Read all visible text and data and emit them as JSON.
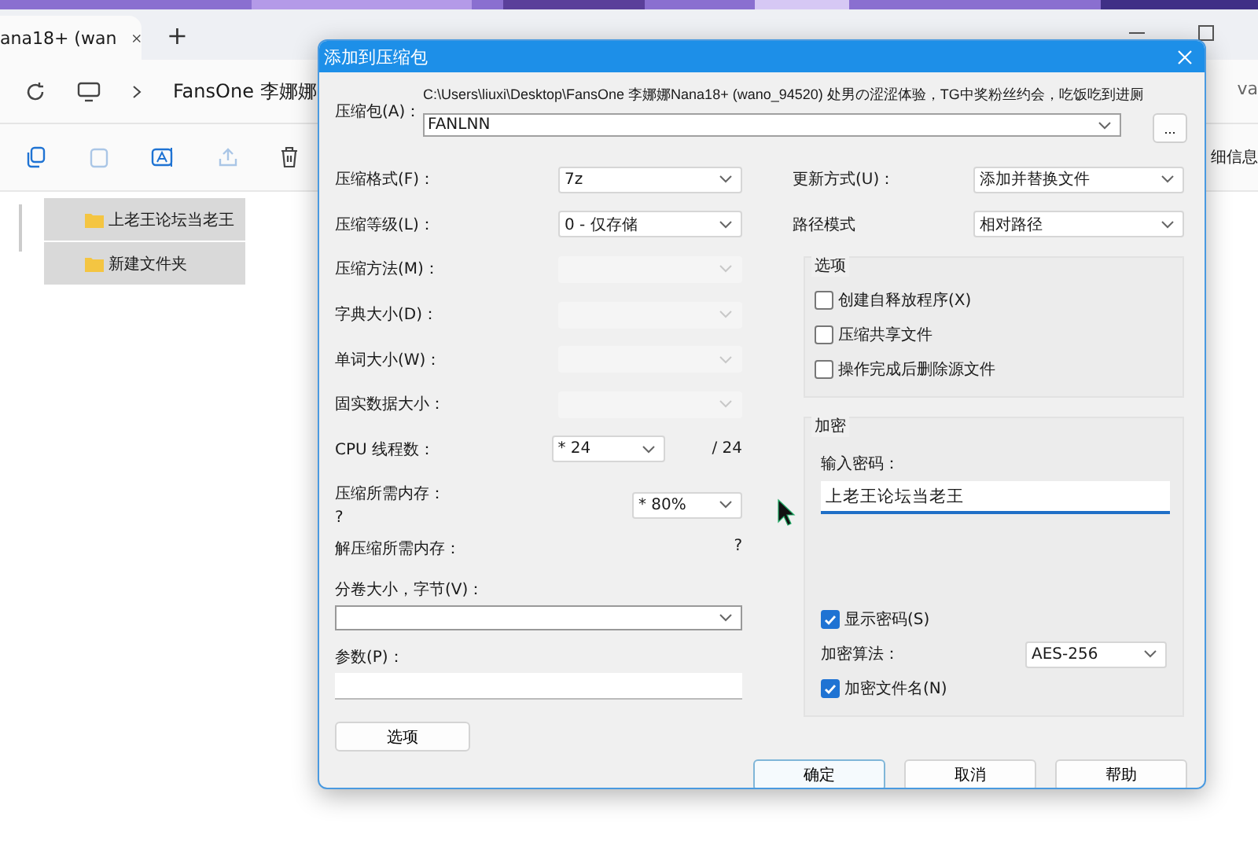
{
  "explorer": {
    "tab_title": "ana18+ (wan",
    "new_tab": "+",
    "breadcrumb": "FansOne 李娜娜",
    "search_partial": "va",
    "details": "细信息",
    "folders": [
      {
        "name": "上老王论坛当老王"
      },
      {
        "name": "新建文件夹"
      }
    ]
  },
  "dialog": {
    "title": "添加到压缩包",
    "archive_label": "压缩包(A)：",
    "archive_path": "C:\\Users\\liuxi\\Desktop\\FansOne 李娜娜Nana18+ (wano_94520) 处男の涩涩体验，TG中奖粉丝约会，吃饭吃到进厕",
    "archive_name": "FANLNN",
    "browse": "...",
    "left_fields": [
      {
        "kind": "select",
        "label": "压缩格式(F)：",
        "value": "7z",
        "disabled": false
      },
      {
        "kind": "select",
        "label": "压缩等级(L)：",
        "value": "0 - 仅存储",
        "disabled": false
      },
      {
        "kind": "select",
        "label": "压缩方法(M)：",
        "disabled": true
      },
      {
        "kind": "select",
        "label": "字典大小(D)：",
        "disabled": true
      },
      {
        "kind": "select",
        "label": "单词大小(W)：",
        "disabled": true
      },
      {
        "kind": "select",
        "label": "固实数据大小：",
        "disabled": true
      },
      {
        "kind": "threads",
        "label": "CPU 线程数：",
        "value": "* 24",
        "max": "/ 24"
      },
      {
        "kind": "memory",
        "label": "压缩所需内存：",
        "note": "?",
        "value": "* 80%"
      },
      {
        "kind": "info",
        "label": "解压缩所需内存：",
        "note": "?"
      },
      {
        "kind": "wide_select",
        "label": "分卷大小，字节(V)："
      },
      {
        "kind": "wide_input",
        "label": "参数(P)："
      }
    ],
    "update_label": "更新方式(U)：",
    "update_value": "添加并替换文件",
    "path_label": "路径模式",
    "path_value": "相对路径",
    "options_title": "选项",
    "options": [
      {
        "label": "创建自释放程序(X)",
        "checked": false
      },
      {
        "label": "压缩共享文件",
        "checked": false
      },
      {
        "label": "操作完成后删除源文件",
        "checked": false
      }
    ],
    "encryption_title": "加密",
    "password_label": "输入密码：",
    "password_value": "上老王论坛当老王",
    "show_password": {
      "label": "显示密码(S)",
      "checked": true
    },
    "algorithm_label": "加密算法：",
    "algorithm_value": "AES-256",
    "encrypt_names": {
      "label": "加密文件名(N)",
      "checked": true
    },
    "options_button": "选项",
    "buttons": [
      {
        "label": "确定",
        "default": true
      },
      {
        "label": "取消",
        "default": false
      },
      {
        "label": "帮助",
        "default": false
      }
    ]
  }
}
